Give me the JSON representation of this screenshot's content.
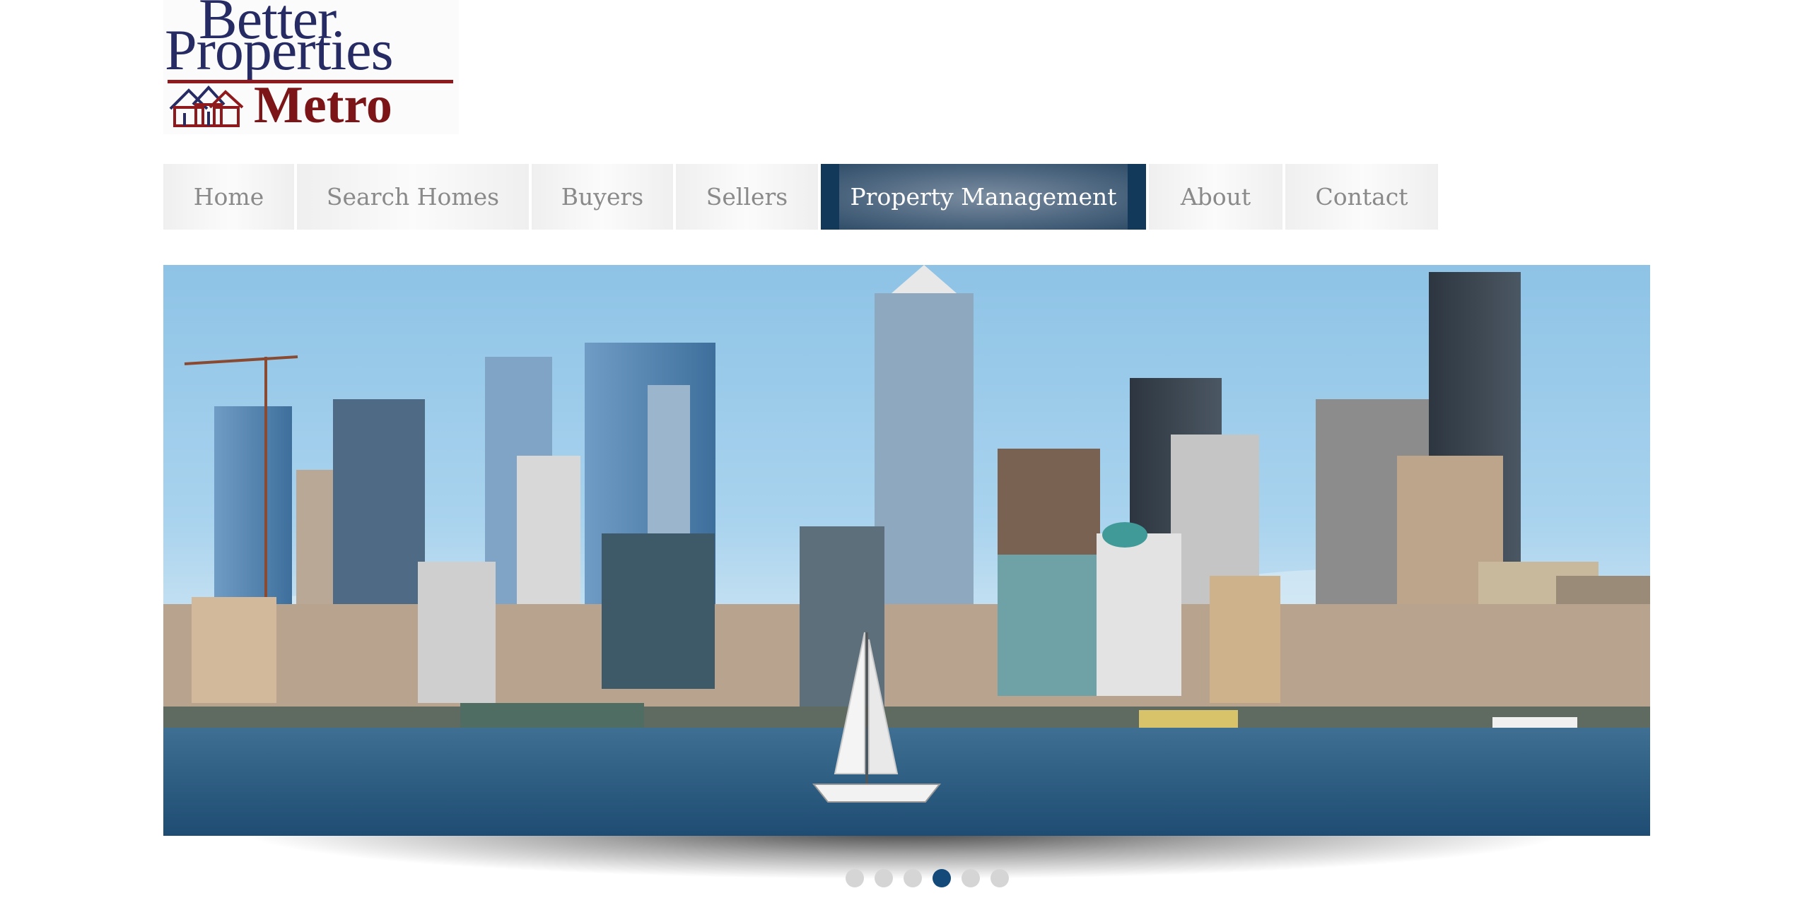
{
  "logo": {
    "line1": "Better",
    "line2": "Properties",
    "line3": "Metro",
    "colors": {
      "navy": "#262b63",
      "maroon": "#8f1a1d"
    }
  },
  "nav": {
    "items": [
      {
        "label": "Home"
      },
      {
        "label": "Search Homes"
      },
      {
        "label": "Buyers"
      },
      {
        "label": "Sellers"
      },
      {
        "label": "Property Management",
        "active": true
      },
      {
        "label": "About"
      },
      {
        "label": "Contact"
      }
    ],
    "active_color": "#12385a"
  },
  "slider": {
    "slide_count": 6,
    "active_index": 3,
    "image_subject": "city-skyline-with-sailboat",
    "active_dot_color": "#134a7a",
    "inactive_dot_color": "#d5d5d5"
  }
}
